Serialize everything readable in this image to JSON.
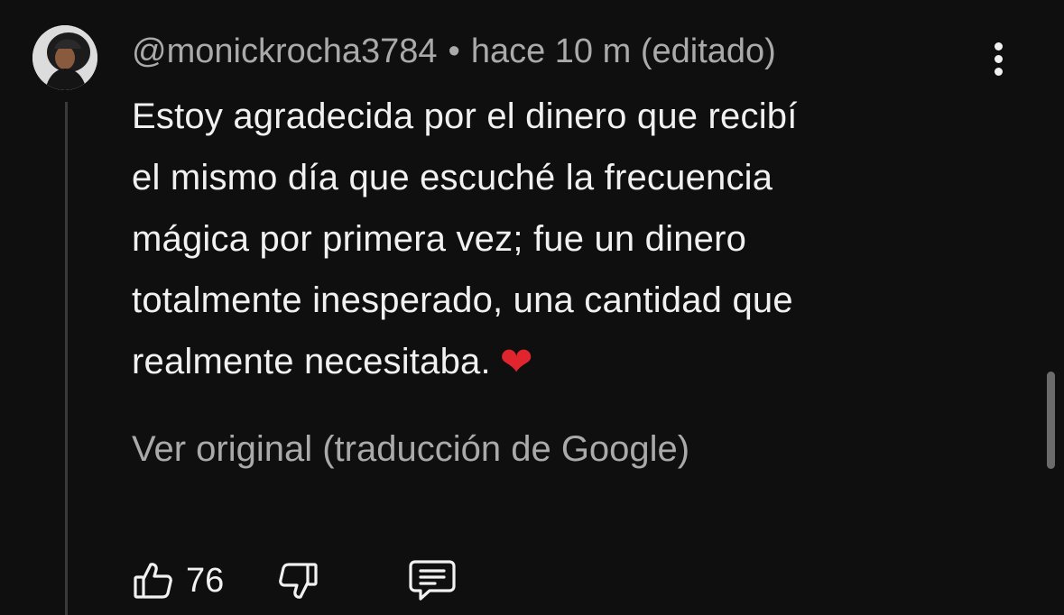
{
  "comment": {
    "author": "@monickrocha3784",
    "separator": "•",
    "time_meta": "hace 10 m (editado)",
    "text_lines": [
      "Estoy agradecida por el dinero que recibí",
      "el mismo día que escuché la frecuencia",
      "mágica por primera vez; fue un dinero",
      "totalmente inesperado, una cantidad que",
      "realmente necesitaba."
    ],
    "emoji": "❤",
    "translation_link": "Ver original (traducción de Google)",
    "likes": "76"
  },
  "icons": {
    "avatar": "avatar",
    "menu": "more-vert-icon",
    "like": "thumb-up-icon",
    "dislike": "thumb-down-icon",
    "reply": "reply-comment-icon"
  },
  "colors": {
    "background": "#0f0f0f",
    "primary_text": "#f1f1f1",
    "secondary_text": "#aaaaaa",
    "heart": "#e0252f"
  }
}
